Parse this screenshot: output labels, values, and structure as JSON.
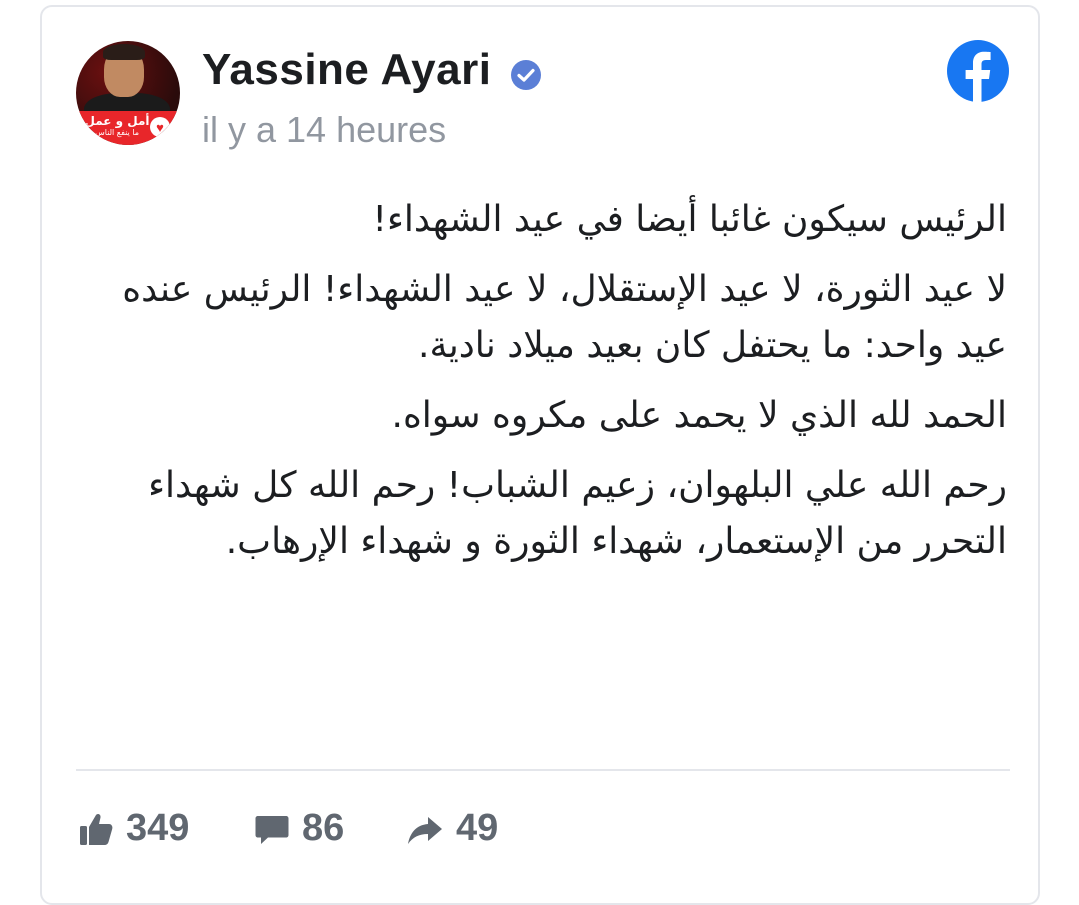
{
  "post": {
    "author": "Yassine Ayari",
    "verified_icon": "verified-badge-icon",
    "time": "il y a 14 heures",
    "source_icon": "facebook-logo-icon",
    "avatar_banner_text": "أمل و عمل",
    "avatar_banner_subtext": "ما ينفع الناس",
    "paragraphs": [
      "الرئيس سيكون غائبا أيضا في عيد الشهداء!",
      "لا عيد الثورة، لا عيد الإستقلال، لا عيد الشهداء! الرئيس عنده عيد واحد: ما يحتفل كان بعيد ميلاد نادية.",
      "الحمد لله الذي لا يحمد على مكروه سواه.",
      "رحم الله علي البلهوان، زعيم الشباب! رحم الله كل شهداء التحرر من الإستعمار، شهداء الثورة و شهداء الإرهاب."
    ]
  },
  "stats": {
    "likes": "349",
    "comments": "86",
    "shares": "49"
  },
  "colors": {
    "facebook_blue": "#1877f2",
    "text": "#1c1e21",
    "muted": "#606770",
    "timestamp": "#9197a0"
  }
}
